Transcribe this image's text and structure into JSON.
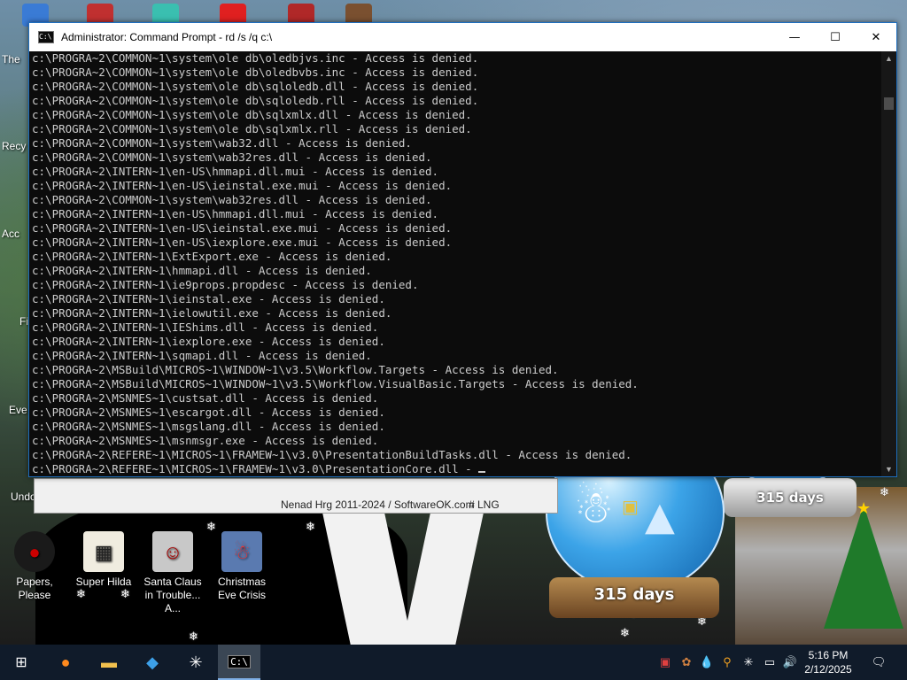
{
  "desktop": {
    "icons": [
      {
        "label": "Papers, Please",
        "icon": "papers-please-icon",
        "color": "#1a1a1a"
      },
      {
        "label": "Super Hilda",
        "icon": "super-hilda-icon",
        "color": "#e8e0d0"
      },
      {
        "label": "Santa Claus in Trouble... A...",
        "icon": "santa-trouble-icon",
        "color": "#c0c0c0"
      },
      {
        "label": "Christmas Eve Crisis",
        "icon": "christmas-eve-crisis-icon",
        "color": "#5a7ab0"
      }
    ],
    "left_stubs": [
      "The",
      "Recy",
      "Acc",
      "Fi",
      "Eve",
      "Undo"
    ]
  },
  "back_window": {
    "credit": "Nenad Hrg 2011-2024 / SoftwareOK.com",
    "lng": "# LNG"
  },
  "cmd": {
    "title": "Administrator: Command Prompt - rd  /s /q c:\\",
    "minimize_icon": "minimize-icon",
    "maximize_icon": "maximize-icon",
    "close_icon": "close-icon",
    "lines": [
      "c:\\PROGRA~2\\COMMON~1\\system\\ole db\\oledbjvs.inc - Access is denied.",
      "c:\\PROGRA~2\\COMMON~1\\system\\ole db\\oledbvbs.inc - Access is denied.",
      "c:\\PROGRA~2\\COMMON~1\\system\\ole db\\sqloledb.dll - Access is denied.",
      "c:\\PROGRA~2\\COMMON~1\\system\\ole db\\sqloledb.rll - Access is denied.",
      "c:\\PROGRA~2\\COMMON~1\\system\\ole db\\sqlxmlx.dll - Access is denied.",
      "c:\\PROGRA~2\\COMMON~1\\system\\ole db\\sqlxmlx.rll - Access is denied.",
      "c:\\PROGRA~2\\COMMON~1\\system\\wab32.dll - Access is denied.",
      "c:\\PROGRA~2\\COMMON~1\\system\\wab32res.dll - Access is denied.",
      "c:\\PROGRA~2\\INTERN~1\\en-US\\hmmapi.dll.mui - Access is denied.",
      "c:\\PROGRA~2\\INTERN~1\\en-US\\ieinstal.exe.mui - Access is denied.",
      "c:\\PROGRA~2\\COMMON~1\\system\\wab32res.dll - Access is denied.",
      "c:\\PROGRA~2\\INTERN~1\\en-US\\hmmapi.dll.mui - Access is denied.",
      "c:\\PROGRA~2\\INTERN~1\\en-US\\ieinstal.exe.mui - Access is denied.",
      "c:\\PROGRA~2\\INTERN~1\\en-US\\iexplore.exe.mui - Access is denied.",
      "c:\\PROGRA~2\\INTERN~1\\ExtExport.exe - Access is denied.",
      "c:\\PROGRA~2\\INTERN~1\\hmmapi.dll - Access is denied.",
      "c:\\PROGRA~2\\INTERN~1\\ie9props.propdesc - Access is denied.",
      "c:\\PROGRA~2\\INTERN~1\\ieinstal.exe - Access is denied.",
      "c:\\PROGRA~2\\INTERN~1\\ielowutil.exe - Access is denied.",
      "c:\\PROGRA~2\\INTERN~1\\IEShims.dll - Access is denied.",
      "c:\\PROGRA~2\\INTERN~1\\iexplore.exe - Access is denied.",
      "c:\\PROGRA~2\\INTERN~1\\sqmapi.dll - Access is denied.",
      "c:\\PROGRA~2\\MSBuild\\MICROS~1\\WINDOW~1\\v3.5\\Workflow.Targets - Access is denied.",
      "c:\\PROGRA~2\\MSBuild\\MICROS~1\\WINDOW~1\\v3.5\\Workflow.VisualBasic.Targets - Access is denied.",
      "c:\\PROGRA~2\\MSNMES~1\\custsat.dll - Access is denied.",
      "c:\\PROGRA~2\\MSNMES~1\\escargot.dll - Access is denied.",
      "c:\\PROGRA~2\\MSNMES~1\\msgslang.dll - Access is denied.",
      "c:\\PROGRA~2\\MSNMES~1\\msnmsgr.exe - Access is denied.",
      "c:\\PROGRA~2\\REFERE~1\\MICROS~1\\FRAMEW~1\\v3.0\\PresentationBuildTasks.dll - Access is denied.",
      "c:\\PROGRA~2\\REFERE~1\\MICROS~1\\FRAMEW~1\\v3.0\\PresentationCore.dll - "
    ]
  },
  "globes": {
    "left_days": "315 days",
    "right_days": "315 days"
  },
  "taskbar": {
    "start_icon": "windows-start-icon",
    "apps": [
      "firefox-icon",
      "file-explorer-icon",
      "app-icon",
      "asterisk-app-icon",
      "command-prompt-icon"
    ],
    "tray_icons": [
      "tray-app-icon-1",
      "tray-app-icon-2",
      "tray-drop-icon",
      "search-tray-icon",
      "asterisk-tray-icon",
      "network-icon",
      "volume-icon"
    ],
    "time": "5:16 PM",
    "date": "2/12/2025",
    "notification_icon": "notification-icon"
  }
}
